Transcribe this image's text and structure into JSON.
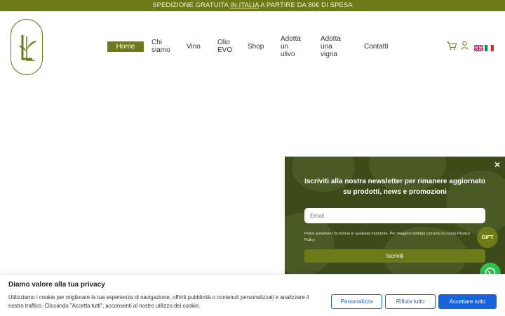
{
  "topbar": {
    "before": "SPEDIZIONE GRATUITA ",
    "link": "IN ITALIA",
    "after": " A PARTIRE DA 80€ DI SPESA"
  },
  "nav": {
    "home": "Home",
    "chi1": "Chi",
    "chi2": "siamo",
    "vino": "Vino",
    "olio1": "Olio",
    "olio2": "EVO",
    "shop": "Shop",
    "ulivo1": "Adotta",
    "ulivo2": "un",
    "ulivo3": "ulivo",
    "vigna1": "Adotta",
    "vigna2": "una",
    "vigna3": "vigna",
    "contatti": "Contatti"
  },
  "icons": {
    "cart": "cart-icon",
    "user": "user-icon",
    "lang_en": "flag-uk-icon",
    "lang_it": "flag-italy-icon"
  },
  "popup": {
    "close": "×",
    "title": "Iscriviti alla nostra newsletter per rimanere aggiornato su prodotti, news e promozioni",
    "email_placeholder": "Email",
    "note": "Potrai annullare l'iscrizione in qualsiasi momento. Per maggiori dettagli consulta la nostra Privacy Policy.",
    "submit": "Iscriviti",
    "gift": "GIFT"
  },
  "cookie": {
    "title": "Diamo valore alla tua privacy",
    "text": "Utilizziamo i cookie per migliorare la tua esperienza di navigazione, offrirti pubblicità o contenuti personalizzati e analizzare il nostro traffico. Cliccando \"Accetta tutti\", acconsenti al nostro utilizzo dei cookie.",
    "customize": "Personalizza",
    "reject": "Rifiuta tutto",
    "accept": "Accettare tutto"
  },
  "colors": {
    "brand_olive": "#6e7a18",
    "popup_bg": "#3d4a1a",
    "cookie_blue": "#1863dc",
    "whatsapp_green": "#2dc14e"
  }
}
